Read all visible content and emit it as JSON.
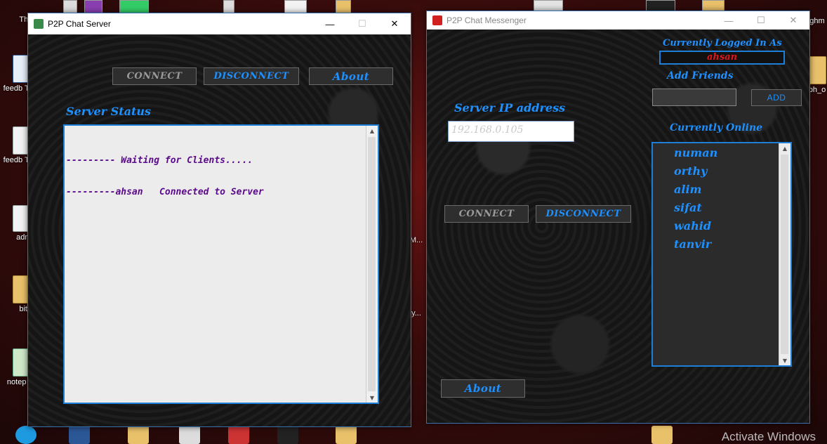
{
  "desktop": {
    "icons": [
      {
        "label": "Thi",
        "kind": "doc"
      },
      {
        "label": "feedb TCP c",
        "kind": "word"
      },
      {
        "label": "feedb TCP c",
        "kind": "doc"
      },
      {
        "label": "admi",
        "kind": "doc"
      },
      {
        "label": "bitr",
        "kind": "folder"
      },
      {
        "label": "notep Sho",
        "kind": "note"
      }
    ],
    "right_labels": [
      "ghm",
      "ph_o",
      "M...",
      "y..."
    ],
    "watermark": "Activate Windows"
  },
  "server_window": {
    "title": "P2P Chat Server",
    "buttons": {
      "connect": "CONNECT",
      "disconnect": "DISCONNECT",
      "about": "About"
    },
    "status_label": "Server Status",
    "status_lines": [
      "--------- Waiting for Clients.....",
      "---------ahsan   Connected to Server"
    ]
  },
  "messenger_window": {
    "title": "P2P Chat Messenger",
    "logged_in_label": "Currently Logged In As",
    "logged_in_user": "ahsan",
    "add_friends_label": "Add Friends",
    "add_button": "ADD",
    "server_ip_label": "Server IP address",
    "server_ip_value": "192.168.0.105",
    "connect_button": "CONNECT",
    "disconnect_button": "DISCONNECT",
    "online_label": "Currently Online",
    "online_users": [
      "numan",
      "orthy",
      "alim",
      "sifat",
      "wahid",
      "tanvir"
    ],
    "about_button": "About"
  },
  "colors": {
    "accent_blue": "#1e90ff",
    "status_text": "#5a0a8a",
    "user_red": "#e0161a"
  }
}
